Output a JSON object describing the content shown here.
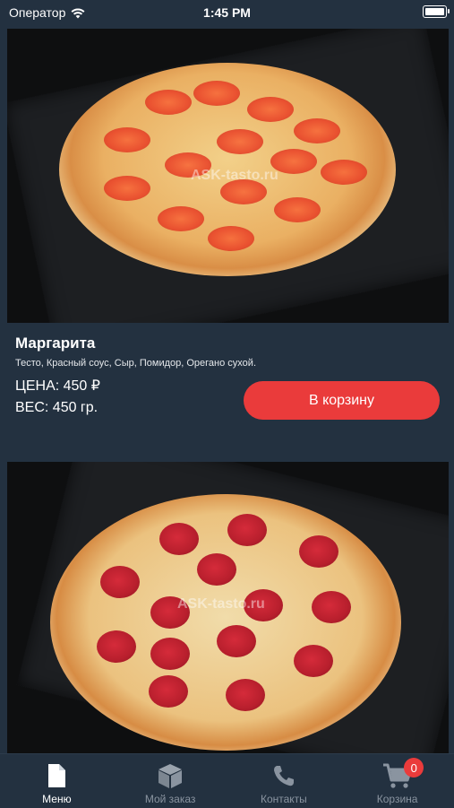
{
  "status_bar": {
    "carrier": "Оператор",
    "time": "1:45 PM"
  },
  "products": [
    {
      "name": "Маргарита",
      "description": "Тесто, Красный соус, Сыр, Помидор, Орегано сухой.",
      "price": "ЦЕНА: 450 ₽",
      "weight": "ВЕС: 450 гр.",
      "button": "В корзину",
      "watermark": "ASK-tasto.ru"
    },
    {
      "watermark": "ASK-tasto.ru"
    }
  ],
  "tab_bar": {
    "tabs": [
      {
        "label": "Меню",
        "icon": "menu-document-icon",
        "active": true
      },
      {
        "label": "Мой заказ",
        "icon": "package-box-icon",
        "active": false
      },
      {
        "label": "Контакты",
        "icon": "phone-icon",
        "active": false
      },
      {
        "label": "Корзина",
        "icon": "cart-icon",
        "active": false,
        "badge": "0"
      }
    ]
  },
  "colors": {
    "background": "#233140",
    "accent": "#ea3b3b",
    "inactive": "#8a94a0"
  }
}
